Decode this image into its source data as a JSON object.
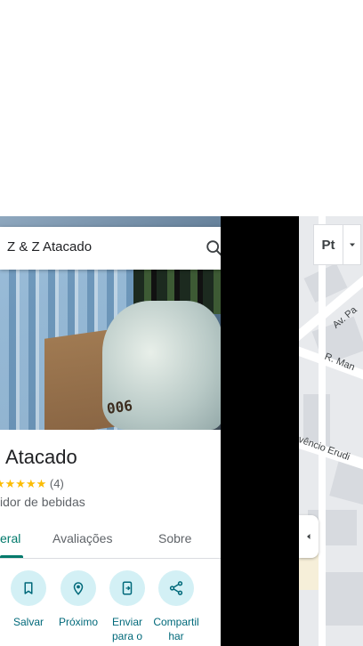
{
  "search": {
    "query": "Z & Z Atacado"
  },
  "place": {
    "title": "Atacado",
    "stars": "★★★★★",
    "review_count": "(4)",
    "category": "idor de bebidas",
    "photo_text": "006"
  },
  "tabs": [
    {
      "label": "eral",
      "active": true
    },
    {
      "label": "Avaliações",
      "active": false
    },
    {
      "label": "Sobre",
      "active": false
    }
  ],
  "actions": [
    {
      "label": "Salvar",
      "icon": "bookmark-icon"
    },
    {
      "label": "Próximo",
      "icon": "nearby-icon"
    },
    {
      "label": "Enviar para o",
      "icon": "send-to-phone-icon"
    },
    {
      "label": "Compartilhar",
      "icon": "share-icon"
    }
  ],
  "map": {
    "layer_button": "Pt",
    "roads": [
      "Av. Pa",
      "R. Man",
      "vêncio Erudi"
    ]
  },
  "colors": {
    "accent": "#00796b",
    "action_bg": "#d3f0f5",
    "star": "#fbbc04"
  }
}
